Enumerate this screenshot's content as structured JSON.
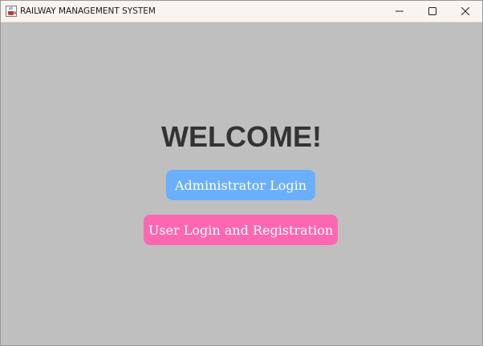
{
  "window": {
    "title": "RAILWAY MANAGEMENT SYSTEM",
    "app_icon": "java-cup-icon",
    "controls": {
      "minimize_icon": "minimize-icon",
      "maximize_icon": "maximize-icon",
      "close_icon": "close-icon"
    }
  },
  "main": {
    "heading": "WELCOME!",
    "admin_button_label": "Administrator Login",
    "user_button_label": "User Login and Registration"
  },
  "colors": {
    "background": "#bfbfbf",
    "heading_text": "#333333",
    "admin_button": "#6aaffc",
    "user_button": "#fd67b2",
    "button_text": "#ffffff",
    "titlebar": "#fbf3f1"
  }
}
